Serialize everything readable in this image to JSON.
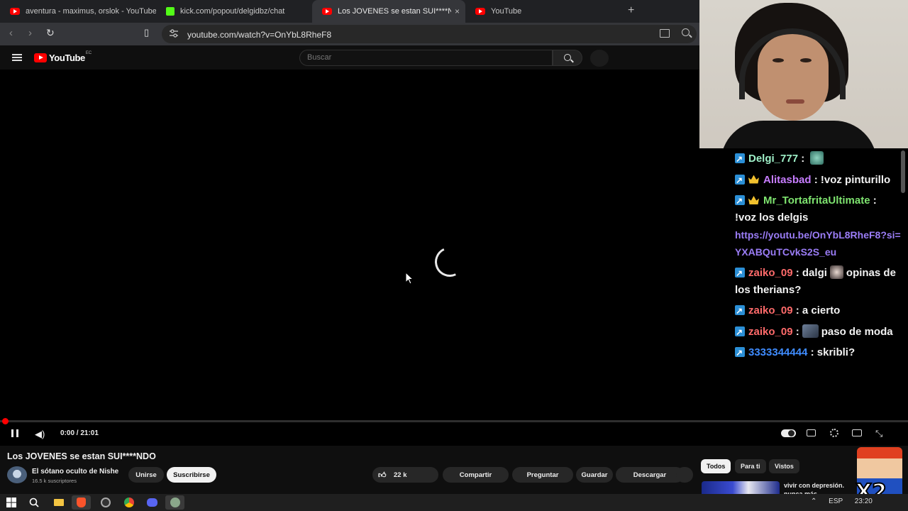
{
  "browser": {
    "tabs": [
      {
        "title": "aventura - maximus, orslok - YouTube",
        "icon": "youtube-icon",
        "active": false
      },
      {
        "title": "kick.com/popout/delgidbz/chat",
        "icon": "kick-icon",
        "active": false
      },
      {
        "title": "Los JOVENES se estan SUI****NDO",
        "icon": "youtube-icon",
        "active": true
      },
      {
        "title": "YouTube",
        "icon": "youtube-icon",
        "active": false
      }
    ],
    "new_tab": "+",
    "close_tab": "×",
    "url": "youtube.com/watch?v=OnYbL8RheF8"
  },
  "youtube": {
    "logo_text": "YouTube",
    "region": "EC",
    "search_placeholder": "Buscar"
  },
  "player": {
    "time": "0:00 / 21:01",
    "progress": 0.0,
    "state": "loading"
  },
  "video": {
    "title": "Los JOVENES se estan SUI****NDO",
    "channel": "El sótano oculto de Nishe",
    "subscribers": "16.5 k suscriptores",
    "join_label": "Unirse",
    "subscribe_label": "Suscribirse",
    "likes": "22 k",
    "share_label": "Compartir",
    "ask_label": "Preguntar",
    "save_label": "Guardar",
    "download_label": "Descargar"
  },
  "recommendations": {
    "chips": [
      "Todos",
      "Para ti",
      "Vistos"
    ],
    "first_title": "vivir con depresión. nunca más"
  },
  "chat": {
    "messages": [
      {
        "user": "Delgi_777",
        "color": "#9ff0c8",
        "crown": false,
        "text": "",
        "emote": "#6fb0a0"
      },
      {
        "user": "Alitasbad",
        "color": "#c77dff",
        "crown": true,
        "text": "!voz pinturillo"
      },
      {
        "user": "Mr_TortafritaUltimate",
        "color": "#7ee36f",
        "crown": true,
        "text": "!voz los delgis",
        "link": "https://youtu.be/OnYbL8RheF8?si=YXABQuTCvkS2S_eu"
      },
      {
        "user": "zaiko_09",
        "color": "#ff6b6b",
        "crown": false,
        "text_before": "dalgi",
        "text": "opinas de los therians?"
      },
      {
        "user": "zaiko_09",
        "color": "#ff6b6b",
        "crown": false,
        "text": "a cierto"
      },
      {
        "user": "zaiko_09",
        "color": "#ff6b6b",
        "crown": false,
        "text": "paso de moda"
      },
      {
        "user": "3333344444",
        "color": "#3f8cff",
        "crown": false,
        "text": "skribli?"
      }
    ],
    "separator": ":"
  },
  "overlay": {
    "multiplier": "X2"
  },
  "taskbar": {
    "language": "ESP",
    "clock": "23:20"
  }
}
